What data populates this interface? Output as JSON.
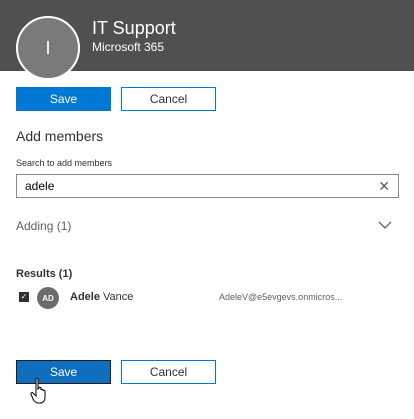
{
  "header": {
    "avatar_initial": "I",
    "title": "IT Support",
    "subtitle": "Microsoft 365"
  },
  "top_actions": {
    "save_label": "Save",
    "cancel_label": "Cancel"
  },
  "add_members": {
    "title": "Add members",
    "search_label": "Search to add members",
    "search_value": "adele",
    "adding_label": "Adding (1)"
  },
  "results": {
    "title": "Results (1)",
    "items": [
      {
        "initials": "AD",
        "first_name": "Adele",
        "last_name": "Vance",
        "email": "AdeleV@e5evgevs.onmicros...",
        "checked": true
      }
    ]
  },
  "bottom_actions": {
    "save_label": "Save",
    "cancel_label": "Cancel"
  },
  "colors": {
    "header_bg": "#505050",
    "primary": "#0078d4",
    "avatar_bg": "#6b6b6b"
  },
  "icons": {
    "clear": "close-icon",
    "expand": "chevron-down-icon",
    "cursor": "hand-pointer-icon"
  }
}
